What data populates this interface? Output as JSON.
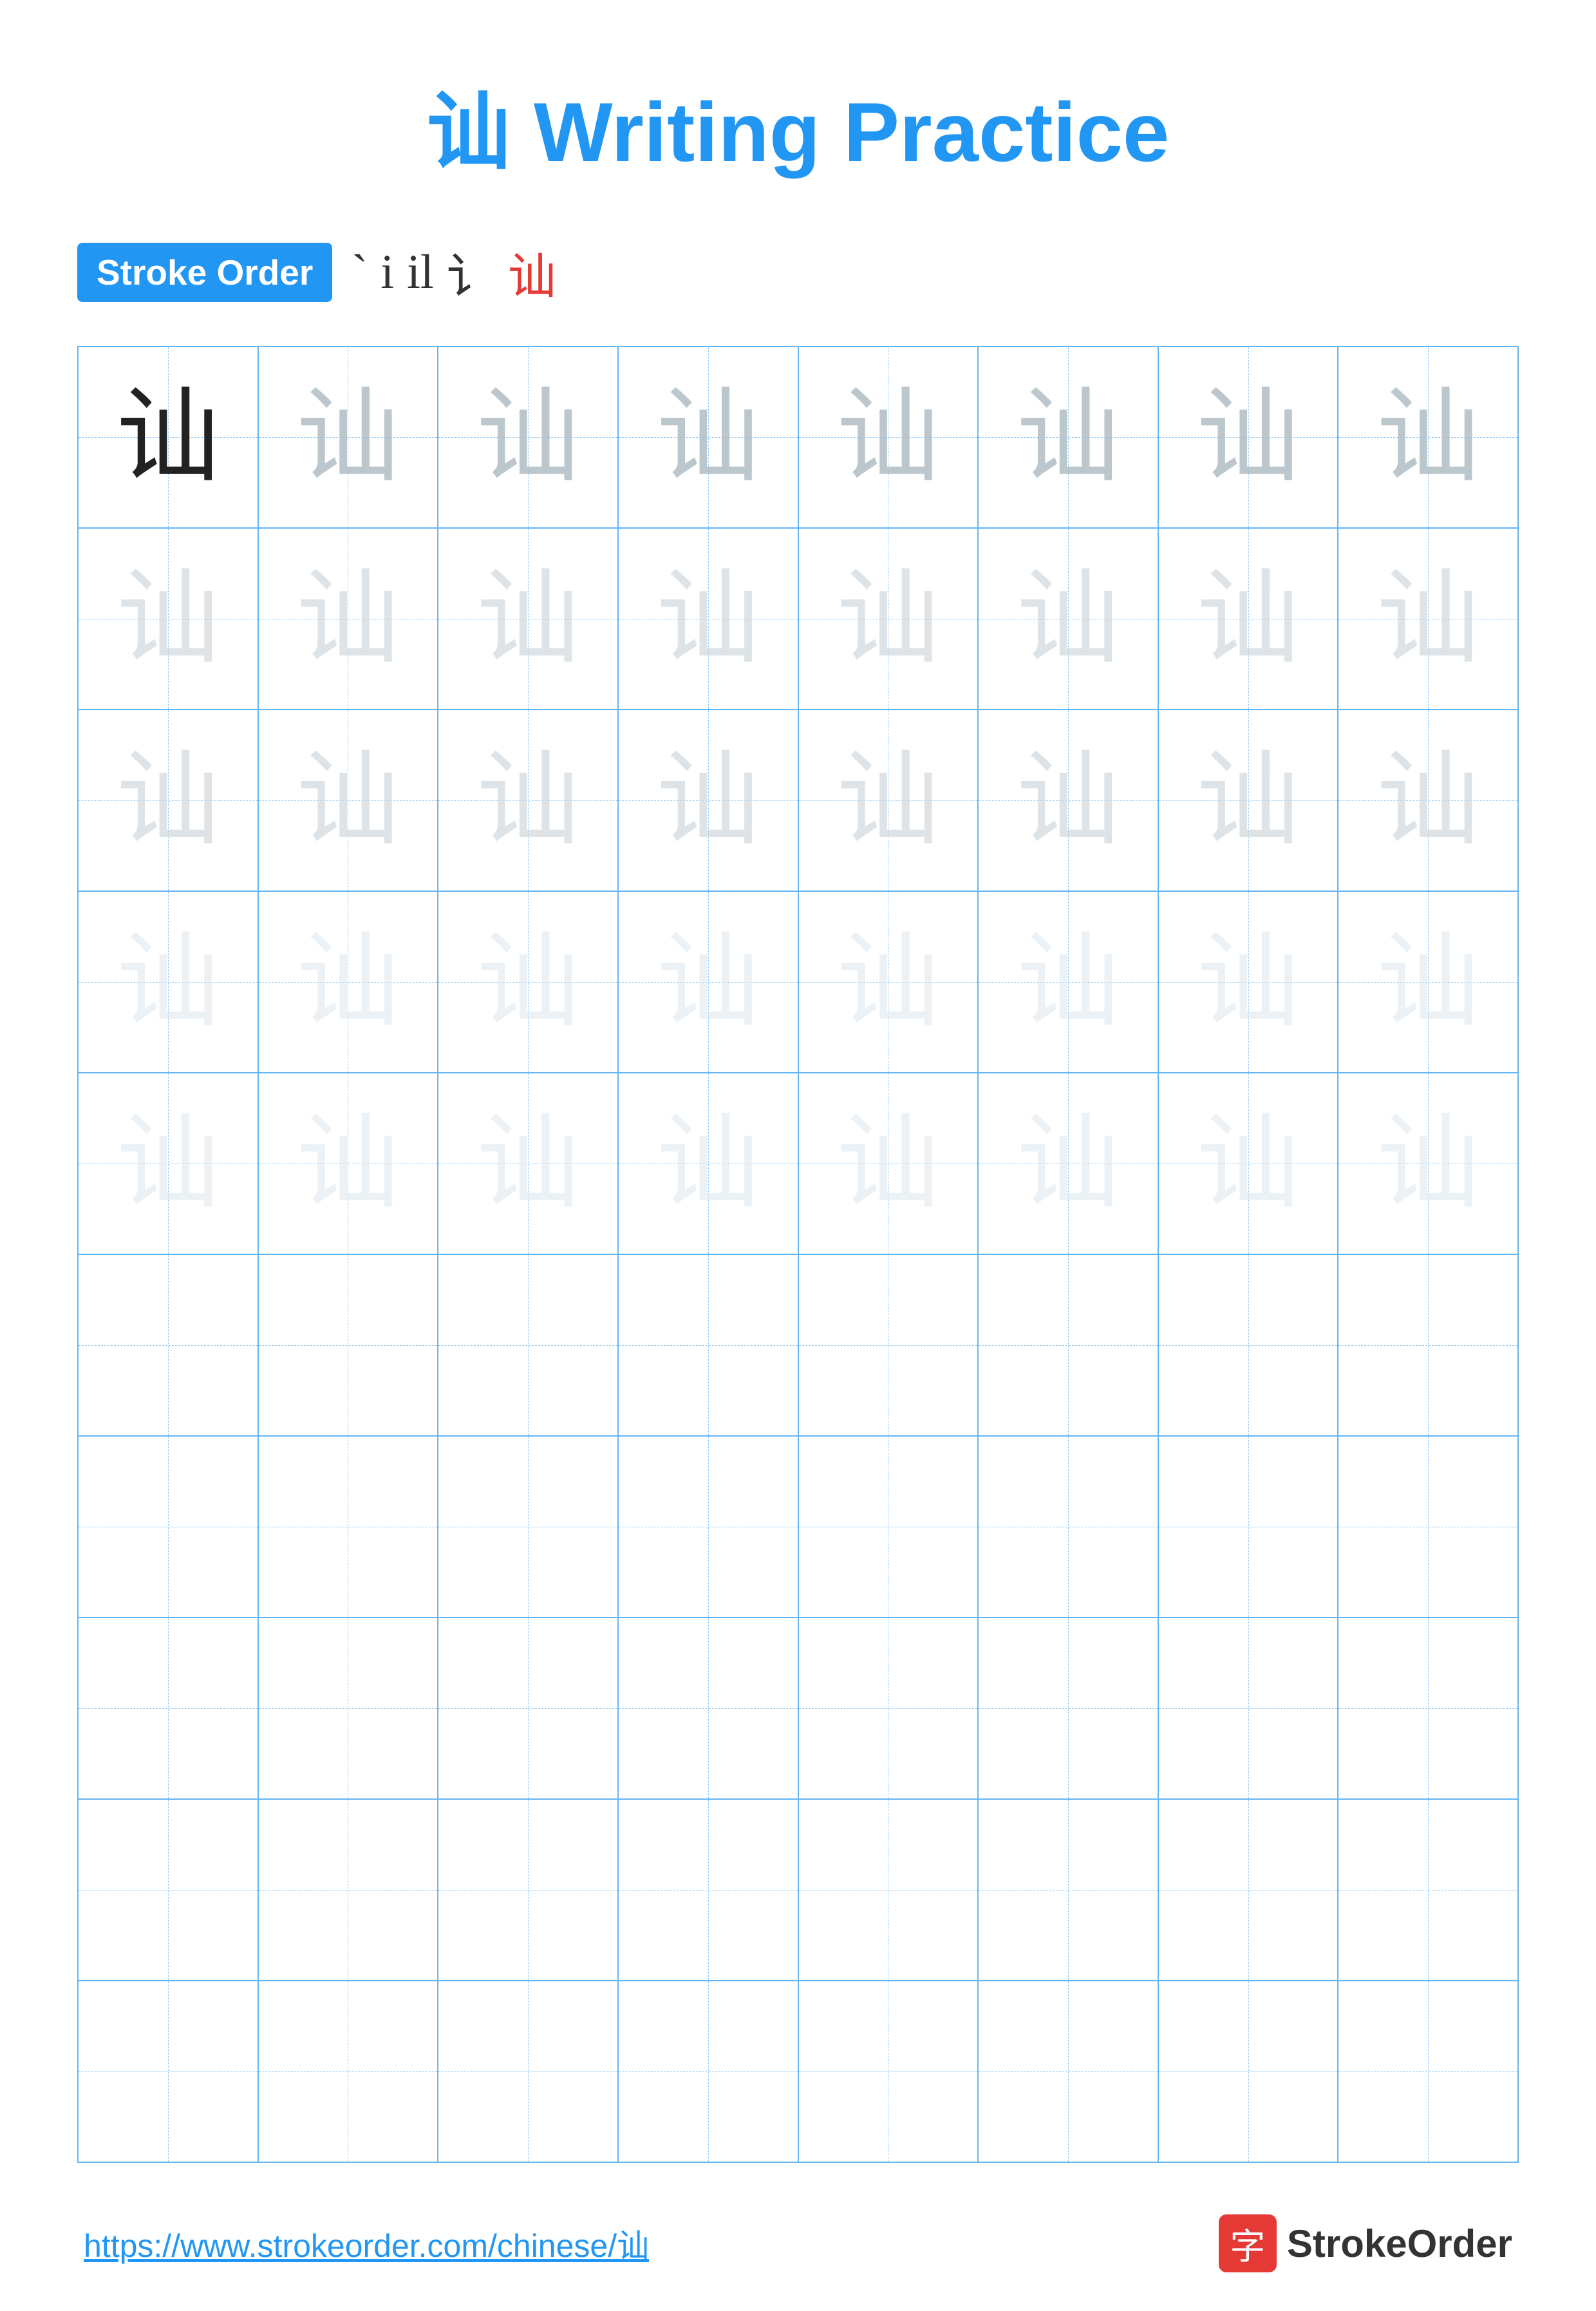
{
  "title": {
    "char": "讪",
    "label": "Writing Practice",
    "full": "讪 Writing Practice"
  },
  "stroke_order": {
    "badge_label": "Stroke Order",
    "steps": [
      "` ",
      "i",
      "il",
      "讠",
      "讪"
    ]
  },
  "grid": {
    "rows": 10,
    "cols": 8,
    "character": "讪",
    "filled_rows": 5,
    "opacities": [
      "dark",
      "light1",
      "light1",
      "light1",
      "light1",
      "light1",
      "light1",
      "light1"
    ]
  },
  "footer": {
    "url": "https://www.strokeorder.com/chinese/讪",
    "logo_char": "字",
    "logo_name": "StrokeOrder"
  }
}
